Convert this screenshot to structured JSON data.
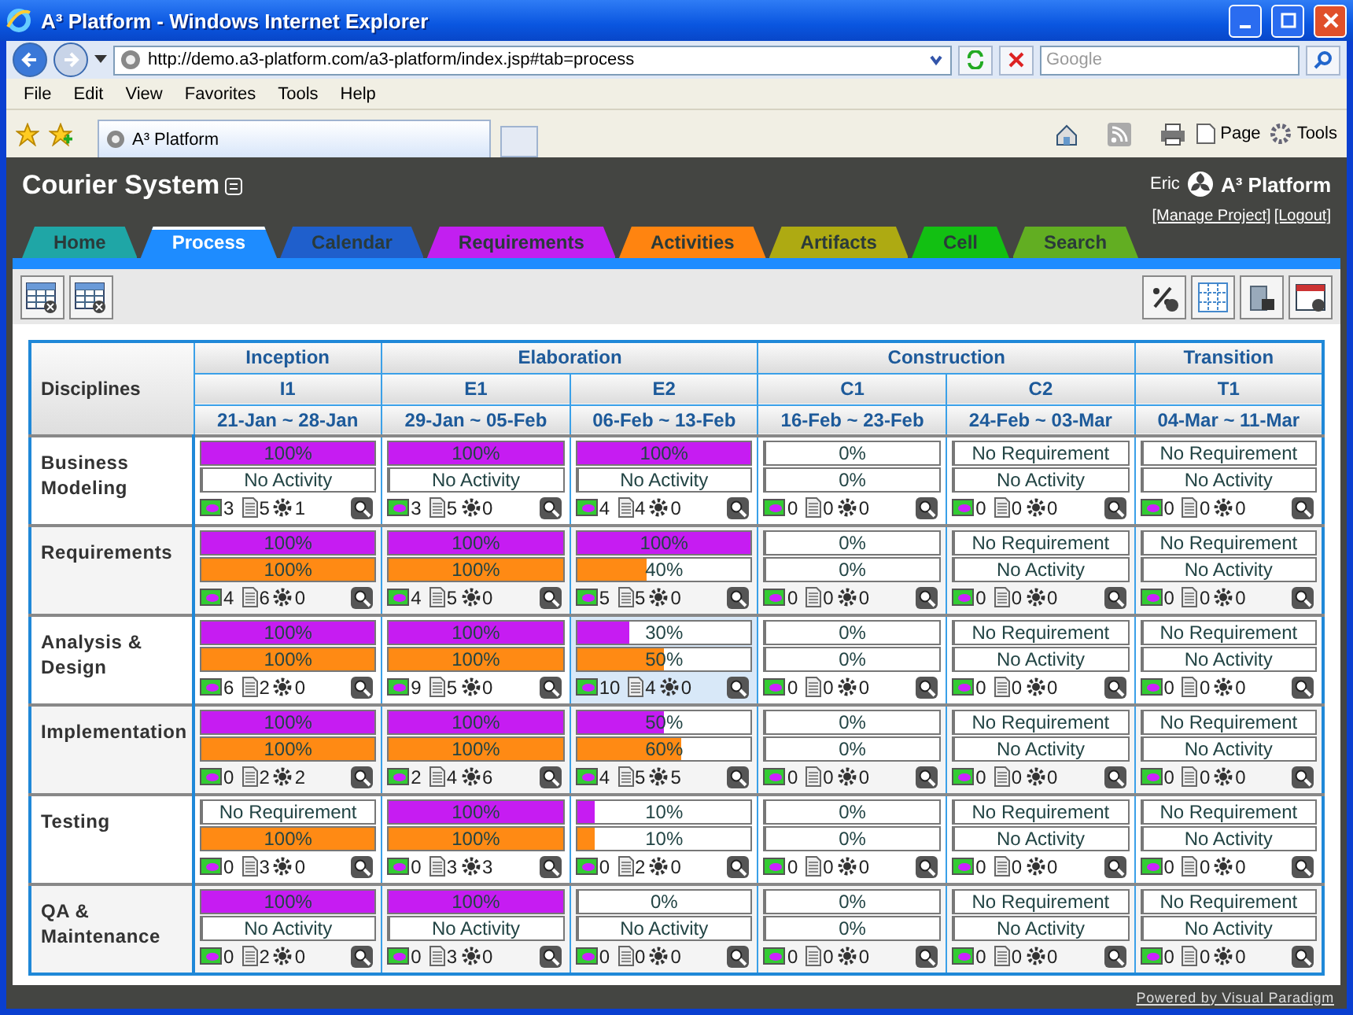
{
  "window": {
    "title": "A³ Platform - Windows Internet Explorer"
  },
  "browser": {
    "url": "http://demo.a3-platform.com/a3-platform/index.jsp#tab=process",
    "search_placeholder": "Google",
    "menu": [
      "File",
      "Edit",
      "View",
      "Favorites",
      "Tools",
      "Help"
    ],
    "tab_title": "A³ Platform",
    "tools": [
      "Page",
      "Tools"
    ]
  },
  "app": {
    "title": "Courier System",
    "user": "Eric",
    "brand": "A³ Platform",
    "links": [
      "[Manage Project]",
      "[Logout]"
    ],
    "tabs": [
      {
        "label": "Home",
        "color": "#1fa6a6",
        "selected": false
      },
      {
        "label": "Process",
        "color": "#1e8cff",
        "selected": true
      },
      {
        "label": "Calendar",
        "color": "#1f5fcc",
        "selected": false
      },
      {
        "label": "Requirements",
        "color": "#c21ff0",
        "selected": false
      },
      {
        "label": "Activities",
        "color": "#ff8410",
        "selected": false
      },
      {
        "label": "Artifacts",
        "color": "#aeaa12",
        "selected": false
      },
      {
        "label": "Cell",
        "color": "#12c012",
        "selected": false
      },
      {
        "label": "Search",
        "color": "#62ae22",
        "selected": false
      }
    ],
    "footer": "Powered by Visual Paradigm"
  },
  "table": {
    "corner": "Disciplines",
    "phases": [
      {
        "name": "Inception",
        "iterations": [
          {
            "name": "I1",
            "dates": "21-Jan ~ 28-Jan"
          }
        ]
      },
      {
        "name": "Elaboration",
        "iterations": [
          {
            "name": "E1",
            "dates": "29-Jan ~ 05-Feb"
          },
          {
            "name": "E2",
            "dates": "06-Feb ~ 13-Feb"
          }
        ]
      },
      {
        "name": "Construction",
        "iterations": [
          {
            "name": "C1",
            "dates": "16-Feb ~ 23-Feb"
          },
          {
            "name": "C2",
            "dates": "24-Feb ~ 03-Mar"
          }
        ]
      },
      {
        "name": "Transition",
        "iterations": [
          {
            "name": "T1",
            "dates": "04-Mar ~ 11-Mar"
          }
        ]
      }
    ],
    "rows": [
      {
        "discipline": "Business Modeling",
        "cells": [
          {
            "req": {
              "text": "100%",
              "level": 1
            },
            "act": {
              "text": "No Activity",
              "level": 0
            },
            "counts": [
              "3",
              "5",
              "1"
            ],
            "hovered": false
          },
          {
            "req": {
              "text": "100%",
              "level": 1
            },
            "act": {
              "text": "No Activity",
              "level": 0
            },
            "counts": [
              "3",
              "5",
              "0"
            ],
            "hovered": false
          },
          {
            "req": {
              "text": "100%",
              "level": 1
            },
            "act": {
              "text": "No Activity",
              "level": 0
            },
            "counts": [
              "4",
              "4",
              "0"
            ],
            "hovered": false
          },
          {
            "req": {
              "text": "0%",
              "level": 0
            },
            "act": {
              "text": "0%",
              "level": 0
            },
            "counts": [
              "0",
              "0",
              "0"
            ],
            "hovered": false
          },
          {
            "req": {
              "text": "No Requirement",
              "level": 0
            },
            "act": {
              "text": "No Activity",
              "level": 0
            },
            "counts": [
              "0",
              "0",
              "0"
            ],
            "hovered": false
          },
          {
            "req": {
              "text": "No Requirement",
              "level": 0
            },
            "act": {
              "text": "No Activity",
              "level": 0
            },
            "counts": [
              "0",
              "0",
              "0"
            ],
            "hovered": false
          }
        ]
      },
      {
        "discipline": "Requirements",
        "cells": [
          {
            "req": {
              "text": "100%",
              "level": 1
            },
            "act": {
              "text": "100%",
              "level": 1
            },
            "counts": [
              "4",
              "6",
              "0"
            ],
            "hovered": false
          },
          {
            "req": {
              "text": "100%",
              "level": 1
            },
            "act": {
              "text": "100%",
              "level": 1
            },
            "counts": [
              "4",
              "5",
              "0"
            ],
            "hovered": false
          },
          {
            "req": {
              "text": "100%",
              "level": 1
            },
            "act": {
              "text": "40%",
              "level": 0.4
            },
            "counts": [
              "5",
              "5",
              "0"
            ],
            "hovered": false
          },
          {
            "req": {
              "text": "0%",
              "level": 0
            },
            "act": {
              "text": "0%",
              "level": 0
            },
            "counts": [
              "0",
              "0",
              "0"
            ],
            "hovered": false
          },
          {
            "req": {
              "text": "No Requirement",
              "level": 0
            },
            "act": {
              "text": "No Activity",
              "level": 0
            },
            "counts": [
              "0",
              "0",
              "0"
            ],
            "hovered": false
          },
          {
            "req": {
              "text": "No Requirement",
              "level": 0
            },
            "act": {
              "text": "No Activity",
              "level": 0
            },
            "counts": [
              "0",
              "0",
              "0"
            ],
            "hovered": false
          }
        ]
      },
      {
        "discipline": "Analysis & Design",
        "cells": [
          {
            "req": {
              "text": "100%",
              "level": 1
            },
            "act": {
              "text": "100%",
              "level": 1
            },
            "counts": [
              "6",
              "2",
              "0"
            ],
            "hovered": false
          },
          {
            "req": {
              "text": "100%",
              "level": 1
            },
            "act": {
              "text": "100%",
              "level": 1
            },
            "counts": [
              "9",
              "5",
              "0"
            ],
            "hovered": false
          },
          {
            "req": {
              "text": "30%",
              "level": 0.3
            },
            "act": {
              "text": "50%",
              "level": 0.5
            },
            "counts": [
              "10",
              "4",
              "0"
            ],
            "hovered": true
          },
          {
            "req": {
              "text": "0%",
              "level": 0
            },
            "act": {
              "text": "0%",
              "level": 0
            },
            "counts": [
              "0",
              "0",
              "0"
            ],
            "hovered": false
          },
          {
            "req": {
              "text": "No Requirement",
              "level": 0
            },
            "act": {
              "text": "No Activity",
              "level": 0
            },
            "counts": [
              "0",
              "0",
              "0"
            ],
            "hovered": false
          },
          {
            "req": {
              "text": "No Requirement",
              "level": 0
            },
            "act": {
              "text": "No Activity",
              "level": 0
            },
            "counts": [
              "0",
              "0",
              "0"
            ],
            "hovered": false
          }
        ]
      },
      {
        "discipline": "Implementation",
        "cells": [
          {
            "req": {
              "text": "100%",
              "level": 1
            },
            "act": {
              "text": "100%",
              "level": 1
            },
            "counts": [
              "0",
              "2",
              "2"
            ],
            "hovered": false
          },
          {
            "req": {
              "text": "100%",
              "level": 1
            },
            "act": {
              "text": "100%",
              "level": 1
            },
            "counts": [
              "2",
              "4",
              "6"
            ],
            "hovered": false
          },
          {
            "req": {
              "text": "50%",
              "level": 0.5
            },
            "act": {
              "text": "60%",
              "level": 0.6
            },
            "counts": [
              "4",
              "5",
              "5"
            ],
            "hovered": false
          },
          {
            "req": {
              "text": "0%",
              "level": 0
            },
            "act": {
              "text": "0%",
              "level": 0
            },
            "counts": [
              "0",
              "0",
              "0"
            ],
            "hovered": false
          },
          {
            "req": {
              "text": "No Requirement",
              "level": 0
            },
            "act": {
              "text": "No Activity",
              "level": 0
            },
            "counts": [
              "0",
              "0",
              "0"
            ],
            "hovered": false
          },
          {
            "req": {
              "text": "No Requirement",
              "level": 0
            },
            "act": {
              "text": "No Activity",
              "level": 0
            },
            "counts": [
              "0",
              "0",
              "0"
            ],
            "hovered": false
          }
        ]
      },
      {
        "discipline": "Testing",
        "cells": [
          {
            "req": {
              "text": "No Requirement",
              "level": 0
            },
            "act": {
              "text": "100%",
              "level": 1
            },
            "counts": [
              "0",
              "3",
              "0"
            ],
            "hovered": false
          },
          {
            "req": {
              "text": "100%",
              "level": 1
            },
            "act": {
              "text": "100%",
              "level": 1
            },
            "counts": [
              "0",
              "3",
              "3"
            ],
            "hovered": false
          },
          {
            "req": {
              "text": "10%",
              "level": 0.1
            },
            "act": {
              "text": "10%",
              "level": 0.1
            },
            "counts": [
              "0",
              "2",
              "0"
            ],
            "hovered": false
          },
          {
            "req": {
              "text": "0%",
              "level": 0
            },
            "act": {
              "text": "0%",
              "level": 0
            },
            "counts": [
              "0",
              "0",
              "0"
            ],
            "hovered": false
          },
          {
            "req": {
              "text": "No Requirement",
              "level": 0
            },
            "act": {
              "text": "No Activity",
              "level": 0
            },
            "counts": [
              "0",
              "0",
              "0"
            ],
            "hovered": false
          },
          {
            "req": {
              "text": "No Requirement",
              "level": 0
            },
            "act": {
              "text": "No Activity",
              "level": 0
            },
            "counts": [
              "0",
              "0",
              "0"
            ],
            "hovered": false
          }
        ]
      },
      {
        "discipline": "QA & Maintenance",
        "cells": [
          {
            "req": {
              "text": "100%",
              "level": 1
            },
            "act": {
              "text": "No Activity",
              "level": 0
            },
            "counts": [
              "0",
              "2",
              "0"
            ],
            "hovered": false
          },
          {
            "req": {
              "text": "100%",
              "level": 1
            },
            "act": {
              "text": "No Activity",
              "level": 0
            },
            "counts": [
              "0",
              "3",
              "0"
            ],
            "hovered": false
          },
          {
            "req": {
              "text": "0%",
              "level": 0
            },
            "act": {
              "text": "No Activity",
              "level": 0
            },
            "counts": [
              "0",
              "0",
              "0"
            ],
            "hovered": false
          },
          {
            "req": {
              "text": "0%",
              "level": 0
            },
            "act": {
              "text": "0%",
              "level": 0
            },
            "counts": [
              "0",
              "0",
              "0"
            ],
            "hovered": false
          },
          {
            "req": {
              "text": "No Requirement",
              "level": 0
            },
            "act": {
              "text": "No Activity",
              "level": 0
            },
            "counts": [
              "0",
              "0",
              "0"
            ],
            "hovered": false
          },
          {
            "req": {
              "text": "No Requirement",
              "level": 0
            },
            "act": {
              "text": "No Activity",
              "level": 0
            },
            "counts": [
              "0",
              "0",
              "0"
            ],
            "hovered": false
          }
        ]
      }
    ]
  }
}
